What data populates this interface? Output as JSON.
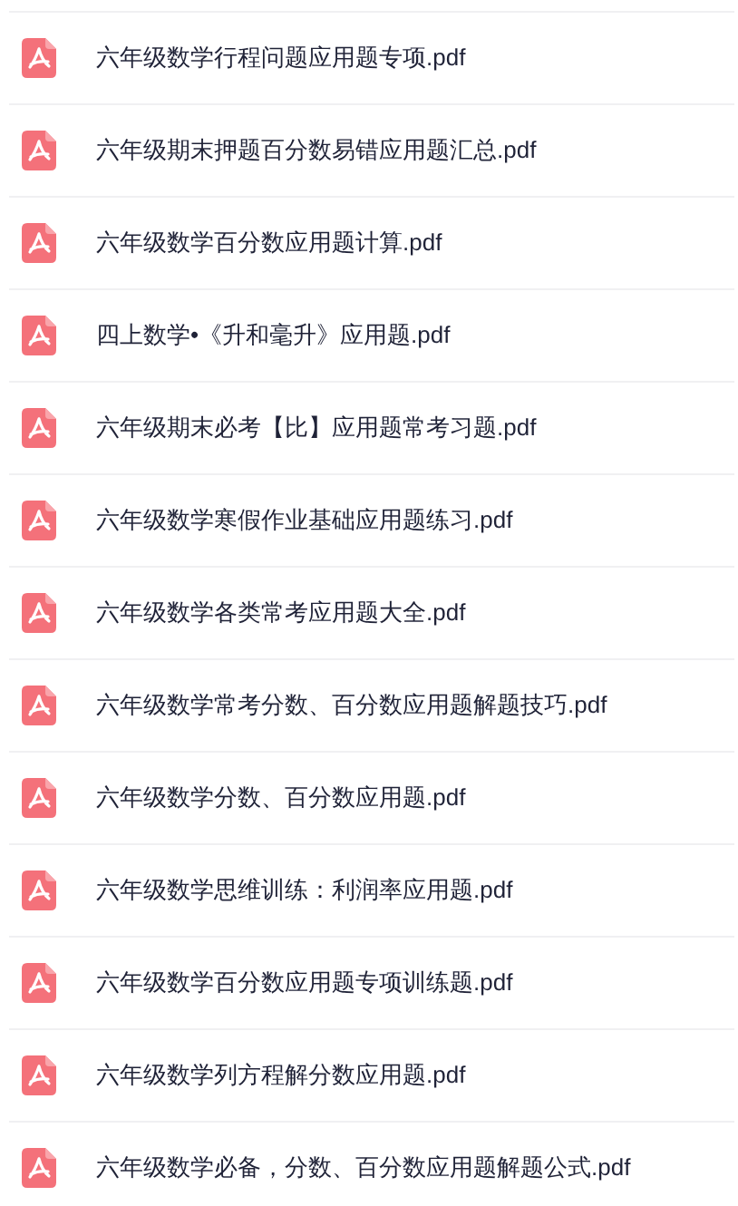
{
  "files": [
    {
      "name": "六年级数学行程问题应用题专项.pdf"
    },
    {
      "name": "六年级期末押题百分数易错应用题汇总.pdf"
    },
    {
      "name": "六年级数学百分数应用题计算.pdf"
    },
    {
      "name": "四上数学•《升和毫升》应用题.pdf"
    },
    {
      "name": "六年级期末必考【比】应用题常考习题.pdf"
    },
    {
      "name": "六年级数学寒假作业基础应用题练习.pdf"
    },
    {
      "name": "六年级数学各类常考应用题大全.pdf"
    },
    {
      "name": "六年级数学常考分数、百分数应用题解题技巧.pdf"
    },
    {
      "name": "六年级数学分数、百分数应用题.pdf"
    },
    {
      "name": "六年级数学思维训练：利润率应用题.pdf"
    },
    {
      "name": "六年级数学百分数应用题专项训练题.pdf"
    },
    {
      "name": "六年级数学列方程解分数应用题.pdf"
    },
    {
      "name": "六年级数学必备，分数、百分数应用题解题公式.pdf"
    }
  ]
}
